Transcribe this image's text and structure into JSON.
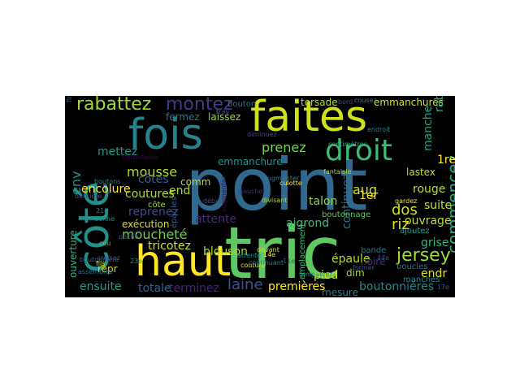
{
  "word_cloud": {
    "background": "#000000",
    "words": [
      {
        "id": "point",
        "text": "point",
        "color": "#31688e"
      },
      {
        "id": "tric",
        "text": "tric",
        "color": "#5ec962"
      },
      {
        "id": "faites",
        "text": "faites",
        "color": "#d0e11c"
      },
      {
        "id": "fois",
        "text": "fois",
        "color": "#26828e"
      },
      {
        "id": "cote",
        "text": "côté",
        "color": "#21918c"
      },
      {
        "id": "haut",
        "text": "haut",
        "color": "#fde725"
      },
      {
        "id": "droit",
        "text": "droit",
        "color": "#3fbc73"
      },
      {
        "id": "rabattez",
        "text": "rabattez",
        "color": "#a0da39"
      },
      {
        "id": "montez",
        "text": "montez",
        "color": "#443983"
      },
      {
        "id": "jersey",
        "text": "jersey",
        "color": "#9fda3a"
      },
      {
        "id": "manche",
        "text": "manche",
        "color": "#1fa187"
      },
      {
        "id": "commencez",
        "text": "commencez",
        "color": "#27ad81"
      },
      {
        "id": "prenez",
        "text": "prenez",
        "color": "#7ad151"
      },
      {
        "id": "mousse",
        "text": "mousse",
        "color": "#addc30"
      },
      {
        "id": "cotes",
        "text": "côtes",
        "color": "#35608d"
      },
      {
        "id": "continuez",
        "text": "continuez",
        "color": "#2e6f8e"
      },
      {
        "id": "aug",
        "text": "aug",
        "color": "#cfe11c"
      },
      {
        "id": "dos",
        "text": "dos",
        "color": "#d5e21a"
      },
      {
        "id": "riz",
        "text": "riz",
        "color": "#e2e418"
      },
      {
        "id": "aigrond",
        "text": "aigrond",
        "color": "#3dbc74"
      },
      {
        "id": "ouvrage",
        "text": "ouvrage",
        "color": "#bddf26"
      },
      {
        "id": "moucheté",
        "text": "moucheté",
        "color": "#6ece58"
      },
      {
        "id": "reprenez",
        "text": "reprenez",
        "color": "#3e4989"
      },
      {
        "id": "tricotez",
        "text": "tricotez",
        "color": "#cae11f"
      },
      {
        "id": "blouson",
        "text": "blouson",
        "color": "#a5db36"
      },
      {
        "id": "attente",
        "text": "attente",
        "color": "#472a7a"
      },
      {
        "id": "epaule",
        "text": "épaule",
        "color": "#b8de29"
      },
      {
        "id": "laine",
        "text": "laine",
        "color": "#3a548c"
      },
      {
        "id": "totale",
        "text": "totale",
        "color": "#32648e"
      },
      {
        "id": "terminez",
        "text": "terminez",
        "color": "#482475"
      },
      {
        "id": "premieres",
        "text": "premières",
        "color": "#fde725"
      },
      {
        "id": "boutonnieres",
        "text": "boutonnières",
        "color": "#25848e"
      },
      {
        "id": "mesure",
        "text": "mesure",
        "color": "#287c8e"
      },
      {
        "id": "ensuite",
        "text": "ensuite",
        "color": "#1f9e89"
      },
      {
        "id": "encolure",
        "text": "encolure",
        "color": "#fde725"
      },
      {
        "id": "coutures",
        "text": "coutures",
        "color": "#addc30"
      },
      {
        "id": "execution",
        "text": "exécution",
        "color": "#d2e21b"
      },
      {
        "id": "pied",
        "text": "pied",
        "color": "#d2e21b"
      },
      {
        "id": "talon",
        "text": "talon",
        "color": "#8bd646"
      },
      {
        "id": "rouge",
        "text": "rouge",
        "color": "#b5de2b"
      },
      {
        "id": "suite",
        "text": "suite",
        "color": "#c8e020"
      },
      {
        "id": "grise",
        "text": "grise",
        "color": "#31b57b"
      },
      {
        "id": "emmanchures",
        "text": "emmanchures",
        "color": "#d8e219"
      },
      {
        "id": "torsade",
        "text": "torsade",
        "color": "#addc30"
      },
      {
        "id": "lastex",
        "text": "lastex",
        "color": "#c2df23"
      },
      {
        "id": "env",
        "text": "env",
        "color": "#20928c"
      },
      {
        "id": "rab",
        "text": "rab",
        "color": "#26ad81"
      },
      {
        "id": "1re",
        "text": "1re",
        "color": "#fde725"
      },
      {
        "id": "1er",
        "text": "1er",
        "color": "#fde725"
      },
      {
        "id": "endr",
        "text": "endr",
        "color": "#dde318"
      },
      {
        "id": "manches",
        "text": "manches",
        "color": "#23898e"
      },
      {
        "id": "mettez",
        "text": "mettez",
        "color": "#1f9a8a"
      },
      {
        "id": "end",
        "text": "end",
        "color": "#addc30"
      },
      {
        "id": "comm",
        "text": "comm",
        "color": "#bade28"
      },
      {
        "id": "ouverture",
        "text": "ouverture",
        "color": "#31b57b"
      },
      {
        "id": "emmanchure",
        "text": "emmanchure",
        "color": "#1f958b"
      },
      {
        "id": "fermez",
        "text": "fermez",
        "color": "#29788e"
      },
      {
        "id": "laissez",
        "text": "laissez",
        "color": "#9bd93c"
      },
      {
        "id": "bouton",
        "text": "bouton",
        "color": "#2e6e8e"
      },
      {
        "id": "noire",
        "text": "noire",
        "color": "#472c7a"
      },
      {
        "id": "dim",
        "text": "dim",
        "color": "#a2da37"
      },
      {
        "id": "repr",
        "text": "repr",
        "color": "#cde11d"
      },
      {
        "id": "boucles",
        "text": "boucles",
        "color": "#2c738e"
      },
      {
        "id": "ajoutez",
        "text": "ajoutez",
        "color": "#1fa088"
      },
      {
        "id": "bande",
        "text": "bande",
        "color": "#2a768e"
      },
      {
        "id": "former",
        "text": "former",
        "color": "#3b528b"
      },
      {
        "id": "epaules",
        "text": "épaules",
        "color": "#38588c"
      },
      {
        "id": "augmentez",
        "text": "augmentez",
        "color": "#440154"
      },
      {
        "id": "boutonnage",
        "text": "boutonnage",
        "color": "#5ac864"
      },
      {
        "id": "emplacement",
        "text": "emplacement",
        "color": "#3bbb75"
      },
      {
        "id": "gauche",
        "text": "gauche",
        "color": "#46327e"
      },
      {
        "id": "divisant",
        "text": "divisant",
        "color": "#a8db34"
      },
      {
        "id": "culotte",
        "text": "culotte",
        "color": "#fde725"
      },
      {
        "id": "diminuez",
        "text": "diminuez",
        "color": "#3f4788"
      },
      {
        "id": "devant",
        "text": "devant",
        "color": "#cde11d"
      },
      {
        "id": "fantaisie",
        "text": "fantaisie",
        "color": "#b0dd2f"
      },
      {
        "id": "boutonniere",
        "text": "boutonnière",
        "color": "#31668e"
      },
      {
        "id": "couture",
        "text": "couture",
        "color": "#dde318"
      },
      {
        "id": "fils",
        "text": "fils",
        "color": "#e5e419"
      },
      {
        "id": "donne",
        "text": "donne",
        "color": "#1f9e89"
      },
      {
        "id": "endroit",
        "text": "endroit",
        "color": "#26828e"
      },
      {
        "id": "barboteuse",
        "text": "barboteuse",
        "color": "#440154"
      },
      {
        "id": "cousez",
        "text": "cousez",
        "color": "#27808e"
      },
      {
        "id": "bord",
        "text": "bord",
        "color": "#3d4d8a"
      },
      {
        "id": "gardez",
        "text": "gardez",
        "color": "#f6e620"
      },
      {
        "id": "boutons",
        "text": "boutons",
        "color": "#25858e"
      },
      {
        "id": "derniere",
        "text": "dernière",
        "color": "#3b528b"
      },
      {
        "id": "croisez",
        "text": "croisez",
        "color": "#3e4c8a"
      },
      {
        "id": "cote2",
        "text": "côte",
        "color": "#9dd93b"
      },
      {
        "id": "centimetres",
        "text": "centimètres",
        "color": "#21a585"
      },
      {
        "id": "assemblez",
        "text": "assemblez",
        "color": "#2d708e"
      },
      {
        "id": "attente2",
        "text": "attente",
        "color": "#1f968b"
      },
      {
        "id": "23e",
        "text": "23e",
        "color": "#1fa088"
      },
      {
        "id": "21e",
        "text": "21e",
        "color": "#2c728e"
      },
      {
        "id": "14e",
        "text": "14e",
        "color": "#fde725"
      },
      {
        "id": "11e",
        "text": "11e",
        "color": "#3b528b"
      },
      {
        "id": "17e",
        "text": "17e",
        "color": "#3b528b"
      },
      {
        "id": "44e",
        "text": "44e",
        "color": "#3b528b"
      },
      {
        "id": "finissez",
        "text": "finissez",
        "color": "#31688e"
      },
      {
        "id": "debut",
        "text": "début",
        "color": "#3b528b"
      },
      {
        "id": "rabattez2",
        "text": "rabattez",
        "color": "#fde725"
      },
      {
        "id": "augmenter",
        "text": "augmenter",
        "color": "#25838e"
      },
      {
        "id": "remplacez",
        "text": "remplacez",
        "color": "#1f9a8a"
      },
      {
        "id": "continuant",
        "text": "continuant",
        "color": "#26828e"
      },
      {
        "id": "trav",
        "text": "trav",
        "color": "#3b528b"
      },
      {
        "id": "poche",
        "text": "poche",
        "color": "#3b528b"
      },
      {
        "id": "cou",
        "text": "cou",
        "color": "#5ec962"
      }
    ]
  }
}
